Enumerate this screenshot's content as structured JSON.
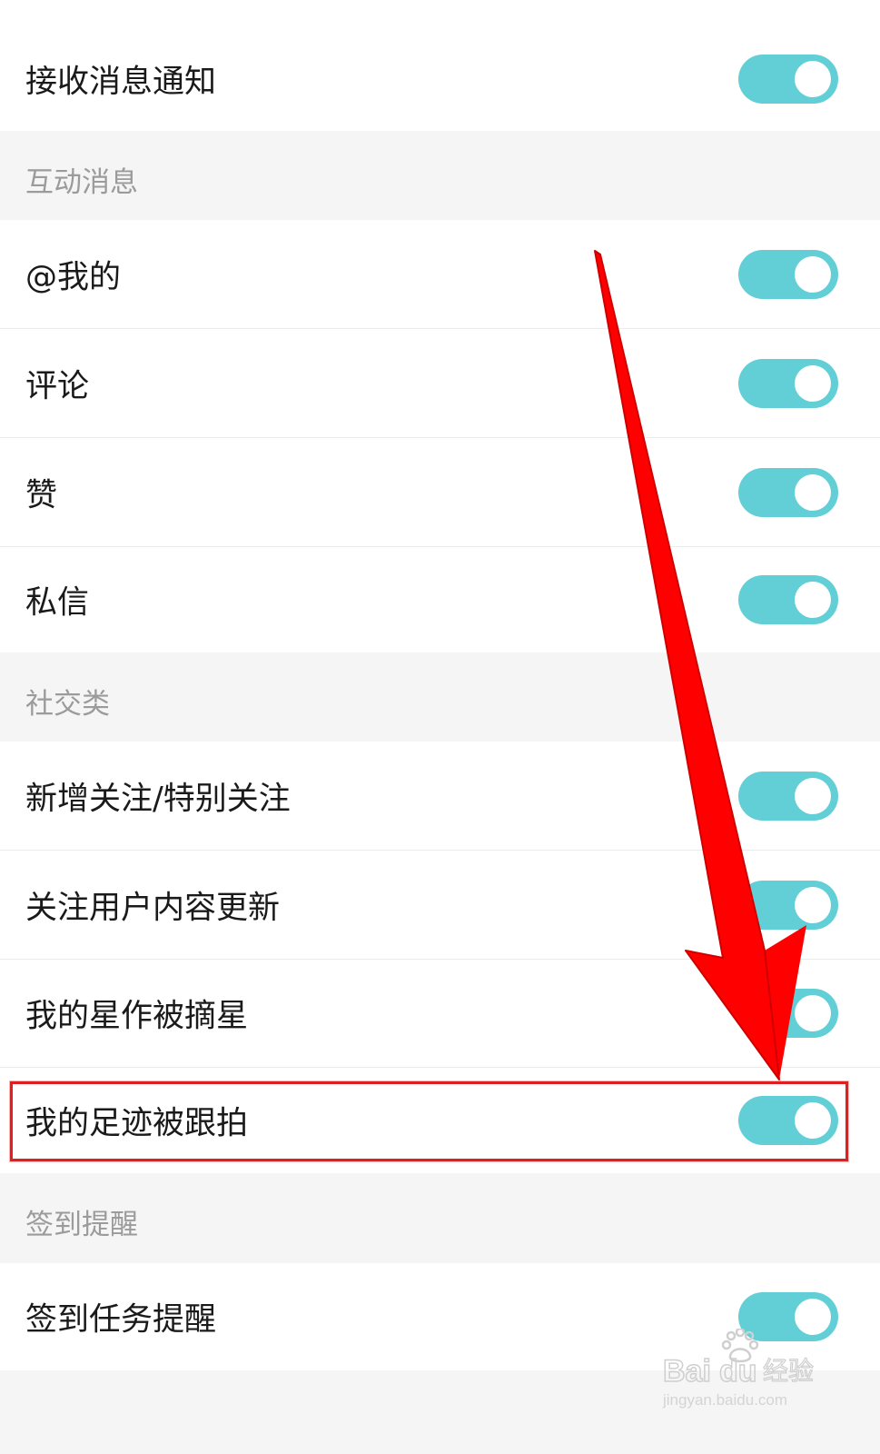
{
  "settings": {
    "receive_notifications": {
      "label": "接收消息通知",
      "enabled": true
    },
    "sections": [
      {
        "header": "互动消息",
        "items": [
          {
            "label": "@我的",
            "enabled": true
          },
          {
            "label": "评论",
            "enabled": true
          },
          {
            "label": "赞",
            "enabled": true
          },
          {
            "label": "私信",
            "enabled": true
          }
        ]
      },
      {
        "header": "社交类",
        "items": [
          {
            "label": "新增关注/特别关注",
            "enabled": true
          },
          {
            "label": "关注用户内容更新",
            "enabled": true
          },
          {
            "label": "我的星作被摘星",
            "enabled": true
          },
          {
            "label": "我的足迹被跟拍",
            "enabled": true
          }
        ]
      },
      {
        "header": "签到提醒",
        "items": [
          {
            "label": "签到任务提醒",
            "enabled": true
          }
        ]
      }
    ]
  },
  "annotation": {
    "highlighted_item": "我的足迹被跟拍",
    "arrow_color": "#ff0000",
    "box_color": "#e02020"
  },
  "watermark": {
    "brand": "Baidu经验",
    "url": "jingyan.baidu.com"
  },
  "colors": {
    "toggle_on": "#62ced6",
    "section_bg": "#f5f5f5",
    "row_bg": "#ffffff"
  }
}
